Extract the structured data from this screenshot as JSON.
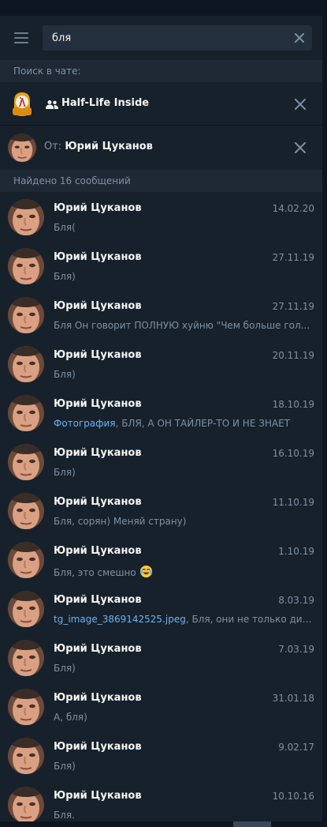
{
  "search": {
    "query": "бля"
  },
  "in_chat_label": "Поиск в чате:",
  "chat": {
    "title": "Half-Life Inside"
  },
  "from_filter": {
    "prefix": "От:",
    "name": "Юрий Цуканов"
  },
  "found_label": "Найдено 16 сообщений",
  "results": [
    {
      "name": "Юрий Цуканов",
      "date": "14.02.20",
      "text": "Бля("
    },
    {
      "name": "Юрий Цуканов",
      "date": "27.11.19",
      "text": "Бля)"
    },
    {
      "name": "Юрий Цуканов",
      "date": "27.11.19",
      "text": "Бля Он говорит ПОЛНУЮ хуйню \"Чем больше гол..."
    },
    {
      "name": "Юрий Цуканов",
      "date": "20.11.19",
      "text": "Бля)"
    },
    {
      "name": "Юрий Цуканов",
      "date": "18.10.19",
      "link": "Фотография",
      "text": ", БЛЯ, А ОН ТАЙЛЕР-ТО И НЕ ЗНАЕТ"
    },
    {
      "name": "Юрий Цуканов",
      "date": "16.10.19",
      "text": "Бля)"
    },
    {
      "name": "Юрий Цуканов",
      "date": "11.10.19",
      "text": "Бля, сорян) Меняй страну)"
    },
    {
      "name": "Юрий Цуканов",
      "date": "1.10.19",
      "text": "Бля, это смешно",
      "emoji": "tears-of-joy"
    },
    {
      "name": "Юрий Цуканов",
      "date": "8.03.19",
      "link": "tg_image_3869142525.jpeg",
      "text": ", Бля, они не только дизай..."
    },
    {
      "name": "Юрий Цуканов",
      "date": "7.03.19",
      "text": "Бля)"
    },
    {
      "name": "Юрий Цуканов",
      "date": "31.01.18",
      "text": "А, бля)"
    },
    {
      "name": "Юрий Цуканов",
      "date": "9.02.17",
      "text": "Бля)"
    },
    {
      "name": "Юрий Цуканов",
      "date": "10.10.16",
      "text": "Бля."
    }
  ],
  "colors": {
    "background": "#17212b",
    "accent_link": "#6ab3f3",
    "muted_text": "#7f91a4"
  }
}
